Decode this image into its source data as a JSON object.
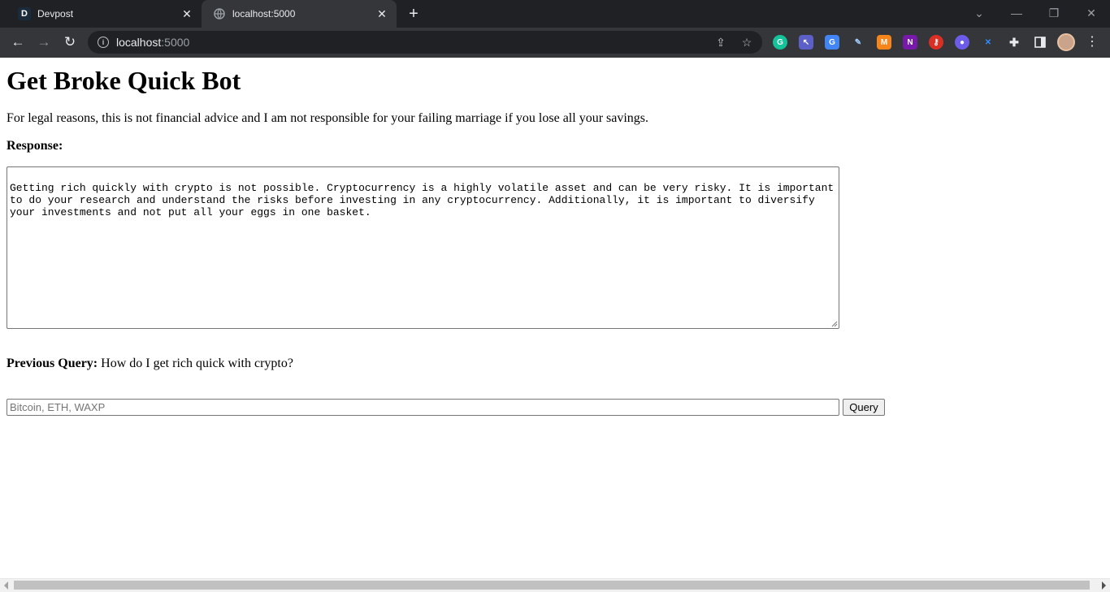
{
  "browser": {
    "tabs": [
      {
        "title": "Devpost",
        "favicon": "D"
      },
      {
        "title": "localhost:5000"
      }
    ],
    "url": {
      "host": "localhost",
      "port": ":5000"
    },
    "extensions": [
      "grammarly-icon",
      "cursor-extension-icon",
      "google-translate-icon",
      "pen-extension-icon",
      "metamask-icon",
      "onenote-icon",
      "key-extension-icon",
      "chat-bot-icon",
      "vscode-extension-icon"
    ]
  },
  "page": {
    "title": "Get Broke Quick Bot",
    "disclaimer": "For legal reasons, this is not financial advice and I am not responsible for your failing marriage if you lose all your savings.",
    "response_label": "Response:",
    "response_text": "Getting rich quickly with crypto is not possible. Cryptocurrency is a highly volatile asset and can be very risky. It is important to do your research and understand the risks before investing in any cryptocurrency. Additionally, it is important to diversify your investments and not put all your eggs in one basket.",
    "previous_query_label": "Previous Query:",
    "previous_query_value": "How do I get rich quick with crypto?",
    "query_placeholder": "Bitcoin, ETH, WAXP",
    "query_value": "",
    "query_button_label": "Query"
  }
}
